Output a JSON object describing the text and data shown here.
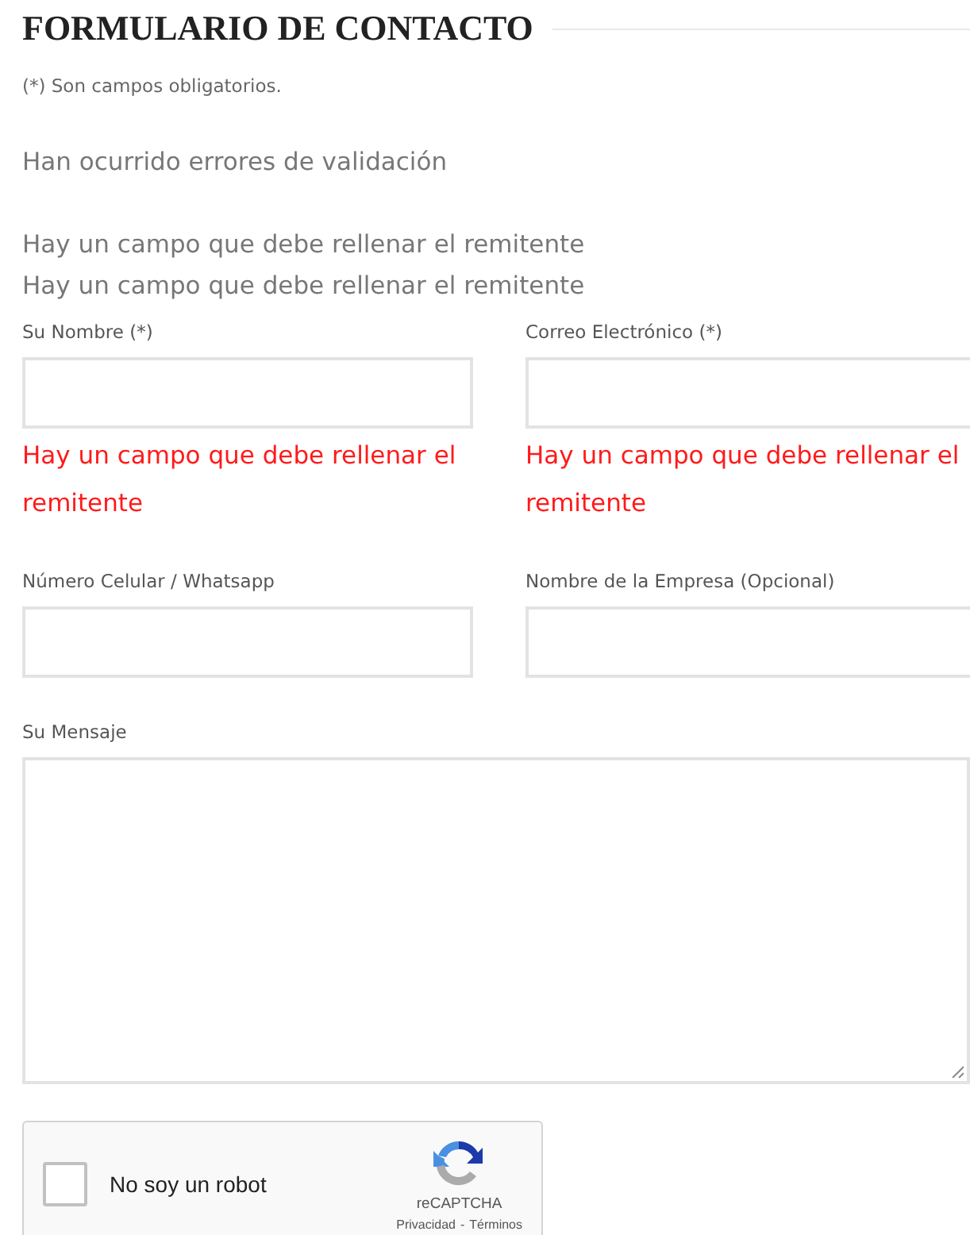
{
  "title": "FORMULARIO DE CONTACTO",
  "required_note": "(*) Son campos obligatorios.",
  "error_summary": "Han ocurrido errores de validación",
  "error_messages": [
    "Hay un campo que debe rellenar el remitente",
    "Hay un campo que debe rellenar el remitente"
  ],
  "fields": [
    {
      "label": "Su Nombre (*)",
      "kind": "input",
      "error": "Hay un campo que debe rellenar el remitente"
    },
    {
      "label": "Correo Electrónico (*)",
      "kind": "input",
      "error": "Hay un campo que debe rellenar el remitente"
    },
    {
      "label": "Número Celular / Whatsapp",
      "kind": "input"
    },
    {
      "label": "Nombre de la Empresa (Opcional)",
      "kind": "input"
    },
    {
      "label": "Su Mensaje",
      "kind": "textarea"
    }
  ],
  "captcha": {
    "label": "No soy un robot",
    "checked": false,
    "brand": "reCAPTCHA",
    "links": [
      "Privacidad",
      "Términos"
    ],
    "separator": "-"
  }
}
